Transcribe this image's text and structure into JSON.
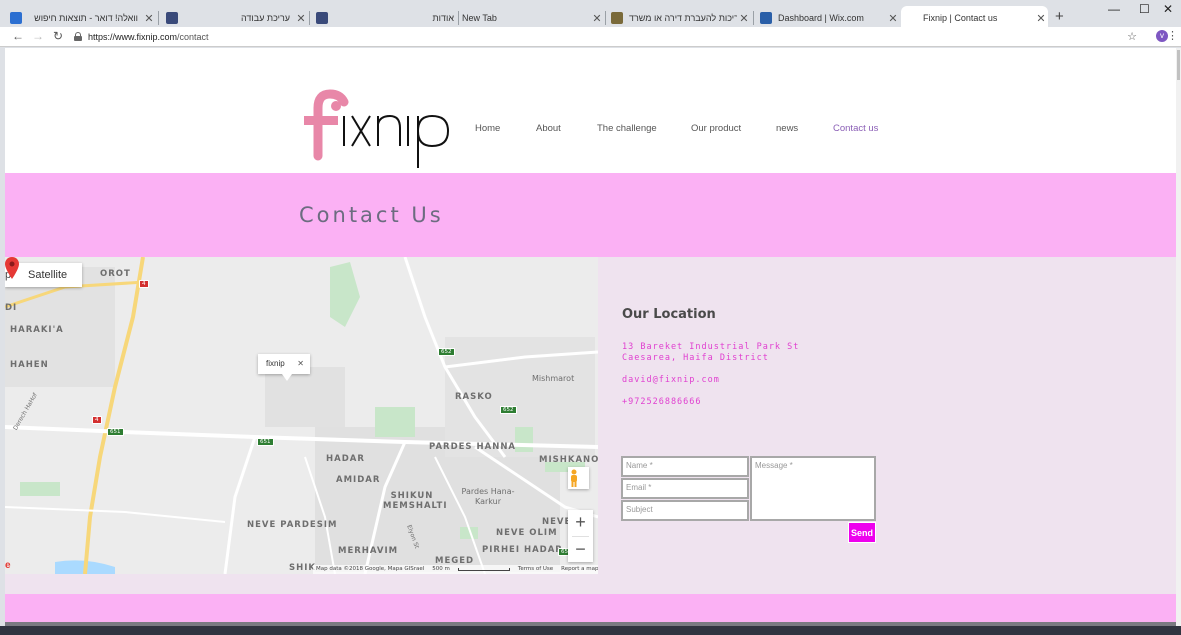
{
  "browser": {
    "tabs": [
      {
        "title": "וואלה! דואר - תוצאות חיפוש",
        "icon": "walla-icon",
        "color": "#2c6fd1"
      },
      {
        "title": "עריכת עבודה",
        "icon": "site-icon",
        "color": "#3a4a7a"
      },
      {
        "title": "אודות",
        "icon": "site-icon",
        "color": "#3a4a7a"
      },
      {
        "title": "New Tab",
        "icon": "",
        "color": ""
      },
      {
        "title": "עריכות להעברת דירה או משרד - ...",
        "icon": "image-icon",
        "color": "#7a6a3a"
      },
      {
        "title": "Dashboard | Wix.com",
        "icon": "wix-icon",
        "color": "#2a5fa8"
      },
      {
        "title": "Fixnip | Contact us",
        "icon": "",
        "color": ""
      }
    ],
    "url_host": "https://www.fixnip.com",
    "url_path": "/contact",
    "profile_initial": "v"
  },
  "site": {
    "nav": [
      "Home",
      "About",
      "The challenge",
      "Our product",
      "news",
      "Contact us"
    ],
    "banner_title": "Contact Us",
    "location_title": "Our Location",
    "address_line1": "13 Bareket Industrial Park St",
    "address_line2": "Caesarea, Haifa District",
    "email": "david@fixnip.com",
    "phone": "+972526886666",
    "form": {
      "name_placeholder": "Name *",
      "email_placeholder": "Email *",
      "subject_placeholder": "Subject",
      "message_placeholder": "Message *",
      "send_label": "Send"
    },
    "accent": "#fbb1f4",
    "link_color": "#e040d0"
  },
  "map": {
    "satellite_label": "Satellite",
    "pin_label": "fixnip",
    "places": [
      "OROT",
      "HARAKI'A",
      "HAHEN",
      "RASKO",
      "Mishmarot",
      "PARDES HANNA",
      "HADAR",
      "AMIDAR",
      "SHIKUN MEMSHALTI",
      "Pardes Hana-Karkur",
      "MISHKANO",
      "NEVE PARDESIM",
      "MERHAVIM",
      "NEVE OLIM",
      "PIRHEI HADAR",
      "MEGED",
      "NEVE",
      "SHIK",
      "DI",
      "Derech HaHof",
      "Elyon St"
    ],
    "road_numbers": [
      "4",
      "4",
      "651",
      "651",
      "652",
      "652",
      "651"
    ],
    "attribution": [
      "Map data ©2018 Google, Mapa GISrael",
      "500 m",
      "Terms of Use",
      "Report a map error"
    ]
  }
}
